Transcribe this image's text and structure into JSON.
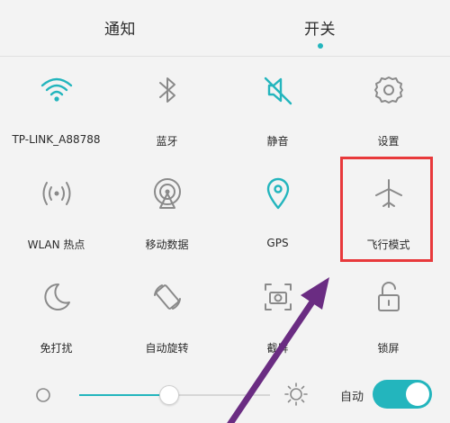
{
  "tabs": {
    "notify": "通知",
    "switch": "开关"
  },
  "toggles": [
    {
      "label": "TP-LINK_A88788",
      "icon": "wifi-icon",
      "active": true
    },
    {
      "label": "蓝牙",
      "icon": "bluetooth-icon",
      "active": false
    },
    {
      "label": "静音",
      "icon": "mute-icon",
      "active": true
    },
    {
      "label": "设置",
      "icon": "gear-icon",
      "active": false
    },
    {
      "label": "WLAN 热点",
      "icon": "hotspot-icon",
      "active": false
    },
    {
      "label": "移动数据",
      "icon": "mobile-data-icon",
      "active": false
    },
    {
      "label": "GPS",
      "icon": "location-pin-icon",
      "active": true
    },
    {
      "label": "飞行模式",
      "icon": "airplane-icon",
      "active": false
    },
    {
      "label": "免打扰",
      "icon": "moon-icon",
      "active": false
    },
    {
      "label": "自动旋转",
      "icon": "rotate-icon",
      "active": false
    },
    {
      "label": "截屏",
      "icon": "screenshot-icon",
      "active": false
    },
    {
      "label": "锁屏",
      "icon": "lock-icon",
      "active": false
    }
  ],
  "brightness": {
    "level": 0.47,
    "auto_label": "自动",
    "auto_on": true
  },
  "colors": {
    "accent": "#23b5bd",
    "icon_grey": "#8a8a8a",
    "highlight_red": "#e8393b",
    "arrow_purple": "#6a2c82"
  }
}
